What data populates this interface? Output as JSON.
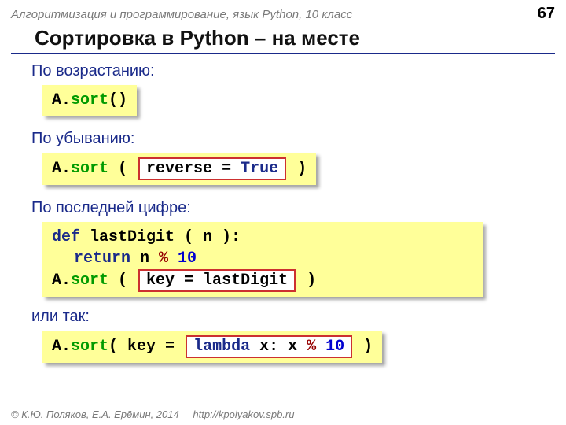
{
  "header": {
    "course": "Алгоритмизация и программирование, язык Python, 10 класс",
    "page": "67"
  },
  "title": "Сортировка в Python – на месте",
  "sections": {
    "asc": {
      "label": "По возрастанию:",
      "code": {
        "a": "A.",
        "sort": "sort",
        "parens": "()"
      }
    },
    "desc": {
      "label": "По убыванию:",
      "code": {
        "a": "A.",
        "sort": "sort",
        "open": " ( ",
        "box_pre": "reverse = ",
        "box_val": "True",
        "close": " )"
      }
    },
    "last": {
      "label": "По последней цифре:",
      "code": {
        "def": "def",
        "fname": " lastDigit ( n ):",
        "ret": "return",
        "expr_pre": " n",
        "mod": " % ",
        "ten": "10",
        "a": "A.",
        "sort": "sort",
        "open": " ( ",
        "box": "key = lastDigit",
        "close": " )"
      }
    },
    "alt": {
      "label": "или так:",
      "code": {
        "a": "A.",
        "sort": "sort",
        "open": "( key =",
        "sp": " ",
        "lambda": "lambda",
        "mid": " x: x",
        "mod": " % ",
        "ten": "10",
        "close": " )"
      }
    }
  },
  "footer": {
    "copyright": "© К.Ю. Поляков, Е.А. Ерёмин, 2014",
    "url": "http://kpolyakov.spb.ru"
  }
}
